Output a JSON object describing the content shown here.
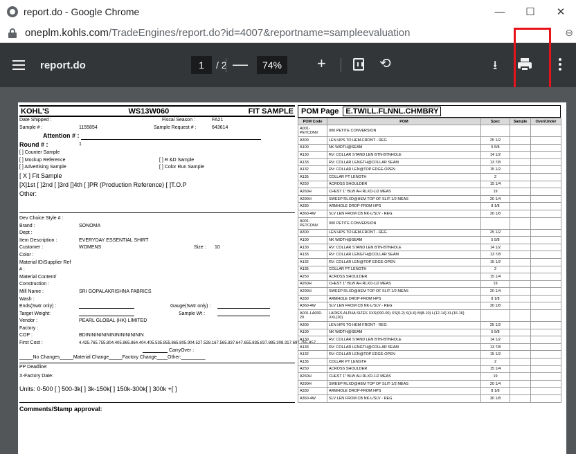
{
  "window": {
    "title": "report.do - Google Chrome",
    "minimize": "—",
    "maximize": "☐",
    "close": "✕"
  },
  "address": {
    "host": "oneplm.kohls.com",
    "path": "/TradeEngines/report.do?id=4007&reportname=sampleevaluation"
  },
  "toolbar": {
    "doc_name": "report.do",
    "page_current": "1",
    "page_total": "/ 2",
    "zoom": "74%",
    "minus": "—",
    "plus": "+"
  },
  "icons": {
    "menu": "hamburger-icon",
    "fit": "fit-to-page-icon",
    "rotate": "rotate-icon",
    "download": "download-icon",
    "print": "print-icon",
    "more": "more-vert-icon",
    "lock": "lock-icon",
    "zoom": "zoom-icon"
  },
  "colors": {
    "toolbar": "#323639",
    "viewer_bg": "#525659",
    "highlight": "#e8121a"
  },
  "left": {
    "brand": "KOHL'S",
    "code": "WS13W060",
    "doc_type": "FIT SAMPLE",
    "date_shipped": "Date Shipped :",
    "fiscal_label": "Fiscal Season :",
    "fiscal": "FA21",
    "sample_label": "Sample # :",
    "sample": "1155854",
    "request_label": "Sample Request # :",
    "request": "643614",
    "attention": "Attention # :",
    "round_label": "Round # :",
    "round": "1",
    "counter": "[  ] Counter Sample",
    "mockup": "[  ] Mockup Reference",
    "rd": "[  ] R &D Sample",
    "advertising": "[  ] Advertising Sample",
    "colorrun": "[  ] Color Run Sample",
    "fit": "[ X ] Fit Sample",
    "rounds": "[X]1st [ ]2nd [ ]3rd []4th [ ]PR (Production Reference) [ ]T.O.P",
    "other": "Other:",
    "dev_choice": "Dev Choice Style # :",
    "brand_label": "Brand :",
    "brand_val": "SONOMA",
    "dept": "Dept :",
    "item_label": "Item Description :",
    "item": "EVERYDAY ESSENTIAL SHIRT",
    "customer_label": "Customer :",
    "customer": "WOMENS",
    "size_label": "Size :",
    "size": "10",
    "color": "Color :",
    "material_id": "Material ID/Supplier Ref",
    "hash": "# :",
    "content": "Material Content/",
    "construction": "Construction :",
    "mill_label": "Mill Name :",
    "mill": "SRI GOPALAKRISHNA FABRICS",
    "wash": "Wash :",
    "ends": "Ends(Swtr only) :",
    "gauge": "Gauge(Swtr only) :",
    "target": "Target Weight:",
    "sample_wt": "Sample Wt :",
    "vendor_label": "Vendor :",
    "vendor": "PEARL GLOBAL (HK) LIMITED",
    "factory": "Factory :",
    "coo_label": "COP :",
    "coo": "BDININININININININININININ",
    "first_cost_label": "First Cost :",
    "first_cost": "4.425.765.755.804.405.865.864.404.405.535.855.865.805.904.527.528.167.565.837.647.655.835.837.885.308.317.697.755.857",
    "carryover": "CarryOver :",
    "changes": "_____No Changes_____Material Change_____Factory Change____Other:_________",
    "pp_deadline": "PP Deadline:",
    "xfactory": "X-Factory Date:",
    "units": "Units: 0-500 [  ] 500-3k[   ] 3k-150k[   ] 150k-300k[   ] 300k +[   ]",
    "comments": "Comments/Stamp approval:"
  },
  "pom": {
    "title": "POM Page",
    "fabric": "E.TWILL.FLNNL.CHMBRY",
    "headers": [
      "POM Code",
      "POM",
      "Spec",
      "Sample",
      "Over/Under"
    ],
    "rows": [
      [
        "A001-PETCONV",
        "000 PETITE CONVERSION",
        ""
      ],
      [
        "A300",
        "LEN HPS TO HEM-FRONT - REG",
        "25 1/2"
      ],
      [
        "A100",
        "NK WIDTH@SEAM",
        "5 5/8"
      ],
      [
        "A130",
        "RV: COLLAR STAND LEN BTN-BTNHOLE",
        "14 1/2"
      ],
      [
        "A133",
        "RV: COLLAR LENGTH@COLLAR SEAM",
        "13 7/8"
      ],
      [
        "A132",
        "RV: COLLAR LEN@TOP EDGE-OPEN",
        "15 1/2"
      ],
      [
        "A135",
        "COLLAR PT LENGTH",
        "2"
      ],
      [
        "A250",
        "ACROSS SHOULDER",
        "15 1/4"
      ],
      [
        "A260H",
        "CHEST 1\" BLW AH RLXD-1/2 MEAS",
        "19"
      ],
      [
        "A290H",
        "SWEEP RLXD@HEM TOP OF SLIT-1/2 MEAS",
        "20 1/4"
      ],
      [
        "A330",
        "ARMHOLE DROP-FROM HPS",
        "8 1/8"
      ],
      [
        "A360-4W",
        "SLV LEN FROM CB NK-L/SLV - REG",
        "30 1/8"
      ],
      [
        "A001-PETCONV",
        "000 PETITE CONVERSION",
        ""
      ],
      [
        "A300",
        "LEN HPS TO HEM-FRONT - REG",
        "25 1/2"
      ],
      [
        "A100",
        "NK WIDTH@SEAM",
        "5 5/8"
      ],
      [
        "A130",
        "RV: COLLAR STAND LEN BTN-BTNHOLE",
        "14 1/2"
      ],
      [
        "A133",
        "RV: COLLAR LENGTH@COLLAR SEAM",
        "13 7/8"
      ],
      [
        "A132",
        "RV: COLLAR LEN@TOP EDGE-OPEN",
        "15 1/2"
      ],
      [
        "A135",
        "COLLAR PT LENGTH",
        "2"
      ],
      [
        "A250",
        "ACROSS SHOULDER",
        "15 1/4"
      ],
      [
        "A260H",
        "CHEST 1\" BLW AH RLXD-1/2 MEAS",
        "19"
      ],
      [
        "A290H",
        "SWEEP RLXD@HEM TOP OF SLIT-1/2 MEAS",
        "20 1/4"
      ],
      [
        "A330",
        "ARMHOLE DROP-FROM HPS",
        "8 1/8"
      ],
      [
        "A360-4W",
        "SLV LEN FROM CB NK-L/SLV - REG",
        "30 1/8"
      ],
      [
        "A001-LA000-20",
        "LADIES ALPHA SIZES XXS(000-00) XS(0-2) S(4-6) M(8-10) L(12-14) XL(16-16) XXL(20)",
        ""
      ],
      [
        "A300",
        "LEN HPS TO HEM-FRONT - REG",
        "25 1/2"
      ],
      [
        "A100",
        "NK WIDTH@SEAM",
        "5 5/8"
      ],
      [
        "A130",
        "RV: COLLAR STAND LEN BTN-BTNHOLE",
        "14 1/2"
      ],
      [
        "A133",
        "RV: COLLAR LENGTH@COLLAR SEAM",
        "13 7/8"
      ],
      [
        "A132",
        "RV: COLLAR LEN@TOP EDGE-OPEN",
        "15 1/2"
      ],
      [
        "A135",
        "COLLAR PT LENGTH",
        "2"
      ],
      [
        "A250",
        "ACROSS SHOULDER",
        "15 1/4"
      ],
      [
        "A260H",
        "CHEST 1\" BLW AH RLXD-1/2 MEAS",
        "19"
      ],
      [
        "A290H",
        "SWEEP RLXD@HEM TOP OF SLIT-1/2 MEAS",
        "20 1/4"
      ],
      [
        "A330",
        "ARMHOLE DROP-FROM HPS",
        "8 1/8"
      ],
      [
        "A360-4W",
        "SLV LEN FROM CB NK-L/SLV - REG",
        "30 1/8"
      ]
    ]
  }
}
